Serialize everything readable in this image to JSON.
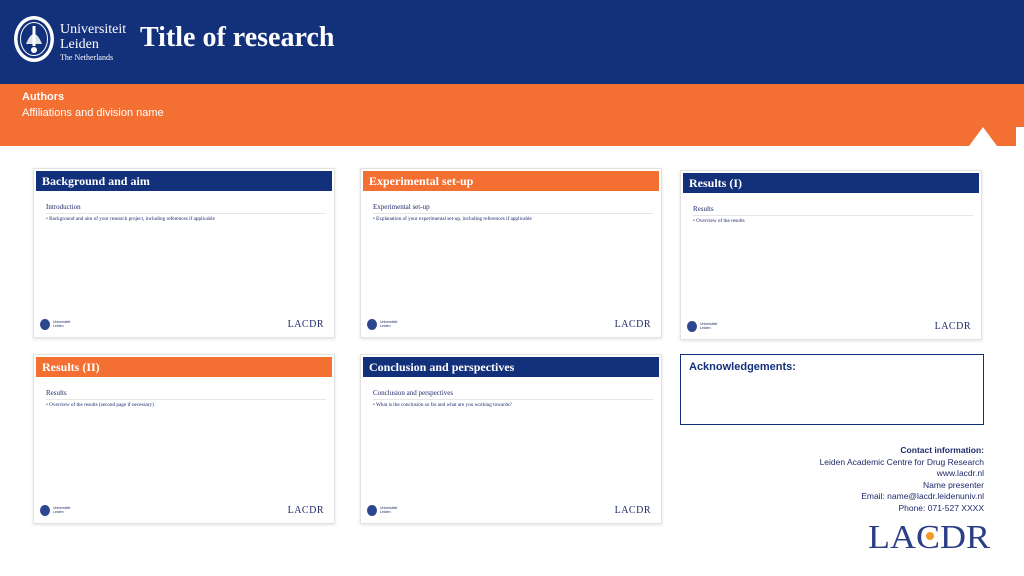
{
  "header": {
    "university": [
      "Universiteit",
      "Leiden",
      "The Netherlands"
    ],
    "title": "Title of research"
  },
  "band": {
    "authors": "Authors",
    "affiliations": "Affiliations and division name"
  },
  "slides": [
    {
      "title": "Background and aim",
      "subtitle": "Introduction",
      "bullet": "• Background and aim of your research project, including references if applicable",
      "logo_text": [
        "Universiteit",
        "Leiden"
      ],
      "brand": "LACDR"
    },
    {
      "title": "Experimental set-up",
      "subtitle": "Experimental set-up",
      "bullet": "• Explanation of your experimental set-up, including references if applicable",
      "logo_text": [
        "Universiteit",
        "Leiden"
      ],
      "brand": "LACDR"
    },
    {
      "title": "Results (I)",
      "subtitle": "Results",
      "bullet": "• Overview of the results",
      "logo_text": [
        "Universiteit",
        "Leiden"
      ],
      "brand": "LACDR"
    },
    {
      "title": "Results (II)",
      "subtitle": "Results",
      "bullet": "• Overview of the results (second page if necessary)",
      "logo_text": [
        "Universiteit",
        "Leiden"
      ],
      "brand": "LACDR"
    },
    {
      "title": "Conclusion and perspectives",
      "subtitle": "Conclusion and perspectives",
      "bullet": "• What is the conclusion so far and what are you working towards?",
      "logo_text": [
        "Universiteit",
        "Leiden"
      ],
      "brand": "LACDR"
    }
  ],
  "acknowledgements": {
    "title": "Acknowledgements:"
  },
  "contact": {
    "label": "Contact information:",
    "lines": [
      "Leiden Academic Centre for Drug Research",
      "www.lacdr.nl",
      "Name presenter",
      "Email: name@lacdr.leidenuniv.nl",
      "Phone: 071-527 XXXX"
    ]
  },
  "footer_logo": "LACDR",
  "colors": {
    "navy": "#13307b",
    "orange": "#f36f32"
  }
}
